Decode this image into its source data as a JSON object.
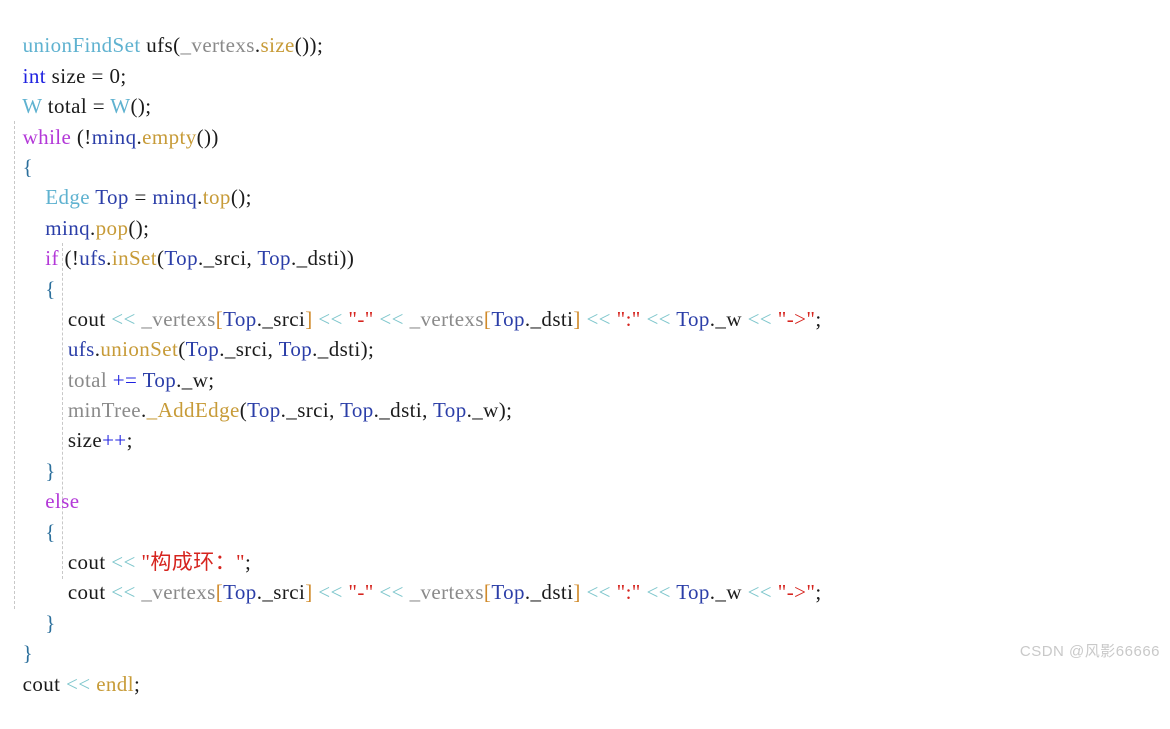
{
  "document": {
    "kind": "code-snippet",
    "language": "C++",
    "background_color": "#ffffff",
    "default_text_color": "#1b1b1b",
    "indent_guide_color": "#c8c8c8",
    "font_size_px": 21,
    "line_height_px": 30.4
  },
  "watermark": {
    "text": "CSDN @风影66666",
    "color": "#c9c9c9"
  },
  "palette": {
    "type": "#5fb2d0",
    "keyword": "#1f22e0",
    "control": "#b338d8",
    "variable": "#2b3ea8",
    "function": "#c79b38",
    "string": "#d6251f",
    "operator": "#7ec6cc",
    "plain": "#1b1b1b",
    "grey": "#8a8a8a",
    "bracket": "#d08a2a",
    "brace": "#2b6f9c"
  },
  "code": {
    "lines": [
      "unionFindSet ufs(_vertexs.size());",
      "int size = 0;",
      "W total = W();",
      "while (!minq.empty())",
      "{",
      "    Edge Top = minq.top();",
      "    minq.pop();",
      "    if (!ufs.inSet(Top._srci, Top._dsti))",
      "    {",
      "        cout << _vertexs[Top._srci] << \"-\" << _vertexs[Top._dsti] << \":\" << Top._w << \"->\";",
      "        ufs.unionSet(Top._srci, Top._dsti);",
      "        total += Top._w;",
      "        minTree._AddEdge(Top._srci, Top._dsti, Top._w);",
      "        size++;",
      "    }",
      "    else",
      "    {",
      "        cout << \"构成环：\";",
      "        cout << _vertexs[Top._srci] << \"-\" << _vertexs[Top._dsti] << \":\" << Top._w << \"->\";",
      "    }",
      "}",
      "cout << endl;"
    ],
    "line_01": {
      "s1": "unionFindSet",
      "s2": " ufs",
      "s3": "(",
      "s4": "_vertexs",
      "s5": ".",
      "s6": "size",
      "s7": "());"
    },
    "line_02": {
      "s1": "int",
      "s2": " size = ",
      "s3": "0",
      "s4": ";"
    },
    "line_03": {
      "s1": "W",
      "s2": " total = ",
      "s3": "W",
      "s4": "();"
    },
    "line_04": {
      "s1": "while",
      "s2": " (!",
      "s3": "minq",
      "s4": ".",
      "s5": "empty",
      "s6": "())"
    },
    "line_05": {
      "s1": "{"
    },
    "line_06": {
      "s1": "Edge",
      "s2": " ",
      "s3": "Top",
      "s4": " = ",
      "s5": "minq",
      "s6": ".",
      "s7": "top",
      "s8": "();"
    },
    "line_07": {
      "s1": "minq",
      "s2": ".",
      "s3": "pop",
      "s4": "();"
    },
    "line_08": {
      "s1": "if",
      "s2": " (!",
      "s3": "ufs",
      "s4": ".",
      "s5": "inSet",
      "s6": "(",
      "s7": "Top",
      "s8": "._srci, ",
      "s9": "Top",
      "s10": "._dsti))"
    },
    "line_09": {
      "s1": "{"
    },
    "line_10": {
      "s1": "cout",
      "s2": " ",
      "s3": "<<",
      "s4": " ",
      "s5": "_vertexs",
      "s6": "[",
      "s7": "Top",
      "s8": "._srci",
      "s9": "]",
      "s10": " ",
      "s11": "<<",
      "s12": " ",
      "s13": "\"-\"",
      "s14": " ",
      "s15": "<<",
      "s16": " ",
      "s17": "_vertexs",
      "s18": "[",
      "s19": "Top",
      "s20": "._dsti",
      "s21": "]",
      "s22": " ",
      "s23": "<<",
      "s24": " ",
      "s25": "\":\"",
      "s26": " ",
      "s27": "<<",
      "s28": " ",
      "s29": "Top",
      "s30": "._w",
      "s31": " ",
      "s32": "<<",
      "s33": " ",
      "s34": "\"->\"",
      "s35": ";"
    },
    "line_11": {
      "s1": "ufs",
      "s2": ".",
      "s3": "unionSet",
      "s4": "(",
      "s5": "Top",
      "s6": "._srci, ",
      "s7": "Top",
      "s8": "._dsti);"
    },
    "line_12": {
      "s1": "total",
      "s2": " ",
      "s3": "+=",
      "s4": " ",
      "s5": "Top",
      "s6": "._w;"
    },
    "line_13": {
      "s1": "minTree",
      "s2": ".",
      "s3": "_AddEdge",
      "s4": "(",
      "s5": "Top",
      "s6": "._srci, ",
      "s7": "Top",
      "s8": "._dsti, ",
      "s9": "Top",
      "s10": "._w);"
    },
    "line_14": {
      "s1": "size",
      "s2": "++",
      "s3": ";"
    },
    "line_15": {
      "s1": "}"
    },
    "line_16": {
      "s1": "else"
    },
    "line_17": {
      "s1": "{"
    },
    "line_18": {
      "s1": "cout",
      "s2": " ",
      "s3": "<<",
      "s4": " ",
      "s5": "\"构成环：\"",
      "s6": ";"
    },
    "line_19": {
      "s1": "cout",
      "s2": " ",
      "s3": "<<",
      "s4": " ",
      "s5": "_vertexs",
      "s6": "[",
      "s7": "Top",
      "s8": "._srci",
      "s9": "]",
      "s10": " ",
      "s11": "<<",
      "s12": " ",
      "s13": "\"-\"",
      "s14": " ",
      "s15": "<<",
      "s16": " ",
      "s17": "_vertexs",
      "s18": "[",
      "s19": "Top",
      "s20": "._dsti",
      "s21": "]",
      "s22": " ",
      "s23": "<<",
      "s24": " ",
      "s25": "\":\"",
      "s26": " ",
      "s27": "<<",
      "s28": " ",
      "s29": "Top",
      "s30": "._w",
      "s31": " ",
      "s32": "<<",
      "s33": " ",
      "s34": "\"->\"",
      "s35": ";"
    },
    "line_20": {
      "s1": "}"
    },
    "line_21": {
      "s1": "}"
    },
    "line_22": {
      "s1": "cout",
      "s2": " ",
      "s3": "<<",
      "s4": " ",
      "s5": "endl",
      "s6": ";"
    }
  }
}
